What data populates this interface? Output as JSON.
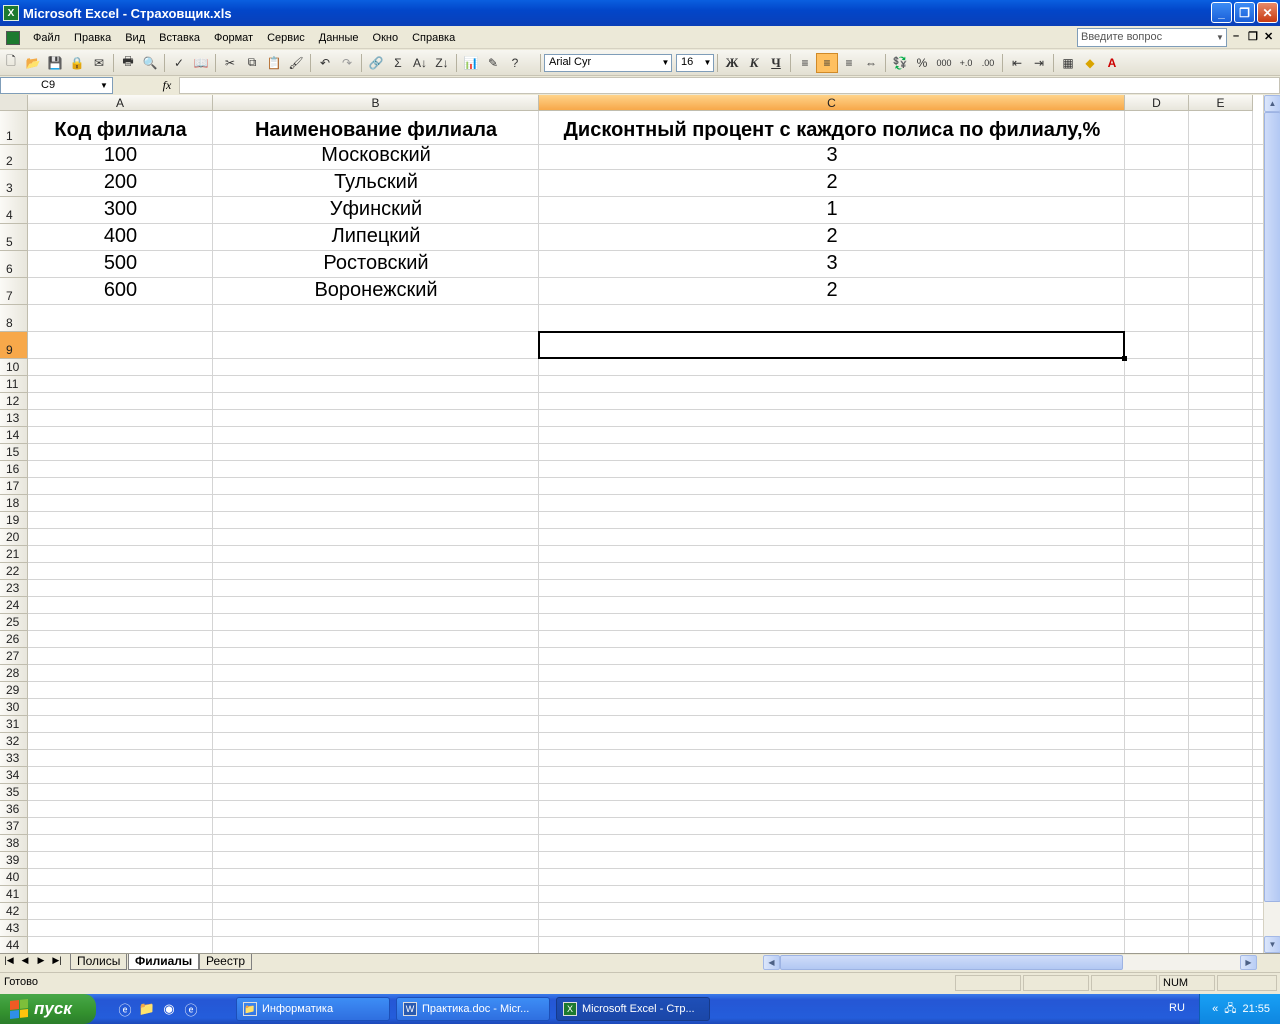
{
  "window": {
    "title": "Microsoft Excel - Страховщик.xls",
    "app_icon": "X"
  },
  "menu": {
    "items": [
      "Файл",
      "Правка",
      "Вид",
      "Вставка",
      "Формат",
      "Сервис",
      "Данные",
      "Окно",
      "Справка"
    ],
    "help_placeholder": "Введите вопрос"
  },
  "toolbar": {
    "font_name": "Arial Cyr",
    "font_size": "16",
    "bold": "Ж",
    "italic": "К",
    "underline": "Ч",
    "sum": "Σ",
    "percent": "%",
    "thousands": "000"
  },
  "formula_bar": {
    "name_box": "C9",
    "fx": "fx",
    "value": ""
  },
  "columns": [
    "A",
    "B",
    "C",
    "D",
    "E"
  ],
  "rows": [
    "1",
    "2",
    "3",
    "4",
    "5",
    "6",
    "7",
    "8",
    "9",
    "10",
    "11",
    "12",
    "13",
    "14",
    "15",
    "16",
    "17",
    "18",
    "19",
    "20",
    "21",
    "22",
    "23",
    "24",
    "25",
    "26",
    "27",
    "28",
    "29",
    "30",
    "31",
    "32",
    "33",
    "34",
    "35",
    "36",
    "37",
    "38",
    "39",
    "40",
    "41",
    "42",
    "43",
    "44"
  ],
  "table": {
    "headers": [
      "Код филиала",
      "Наименование филиала",
      "Дисконтный процент с каждого полиса по филиалу,%"
    ],
    "rows": [
      [
        "100",
        "Московский",
        "3"
      ],
      [
        "200",
        "Тульский",
        "2"
      ],
      [
        "300",
        "Уфинский",
        "1"
      ],
      [
        "400",
        "Липецкий",
        "2"
      ],
      [
        "500",
        "Ростовский",
        "3"
      ],
      [
        "600",
        "Воронежский",
        "2"
      ]
    ]
  },
  "sheets": {
    "tabs": [
      "Полисы",
      "Филиалы",
      "Реестр"
    ],
    "active": "Филиалы"
  },
  "status": {
    "text": "Готово",
    "num": "NUM"
  },
  "taskbar": {
    "start": "пуск",
    "tasks": [
      "Информатика",
      "Практика.doc - Micr...",
      "Microsoft Excel - Стр..."
    ],
    "lang": "RU",
    "clock": "21:55"
  }
}
